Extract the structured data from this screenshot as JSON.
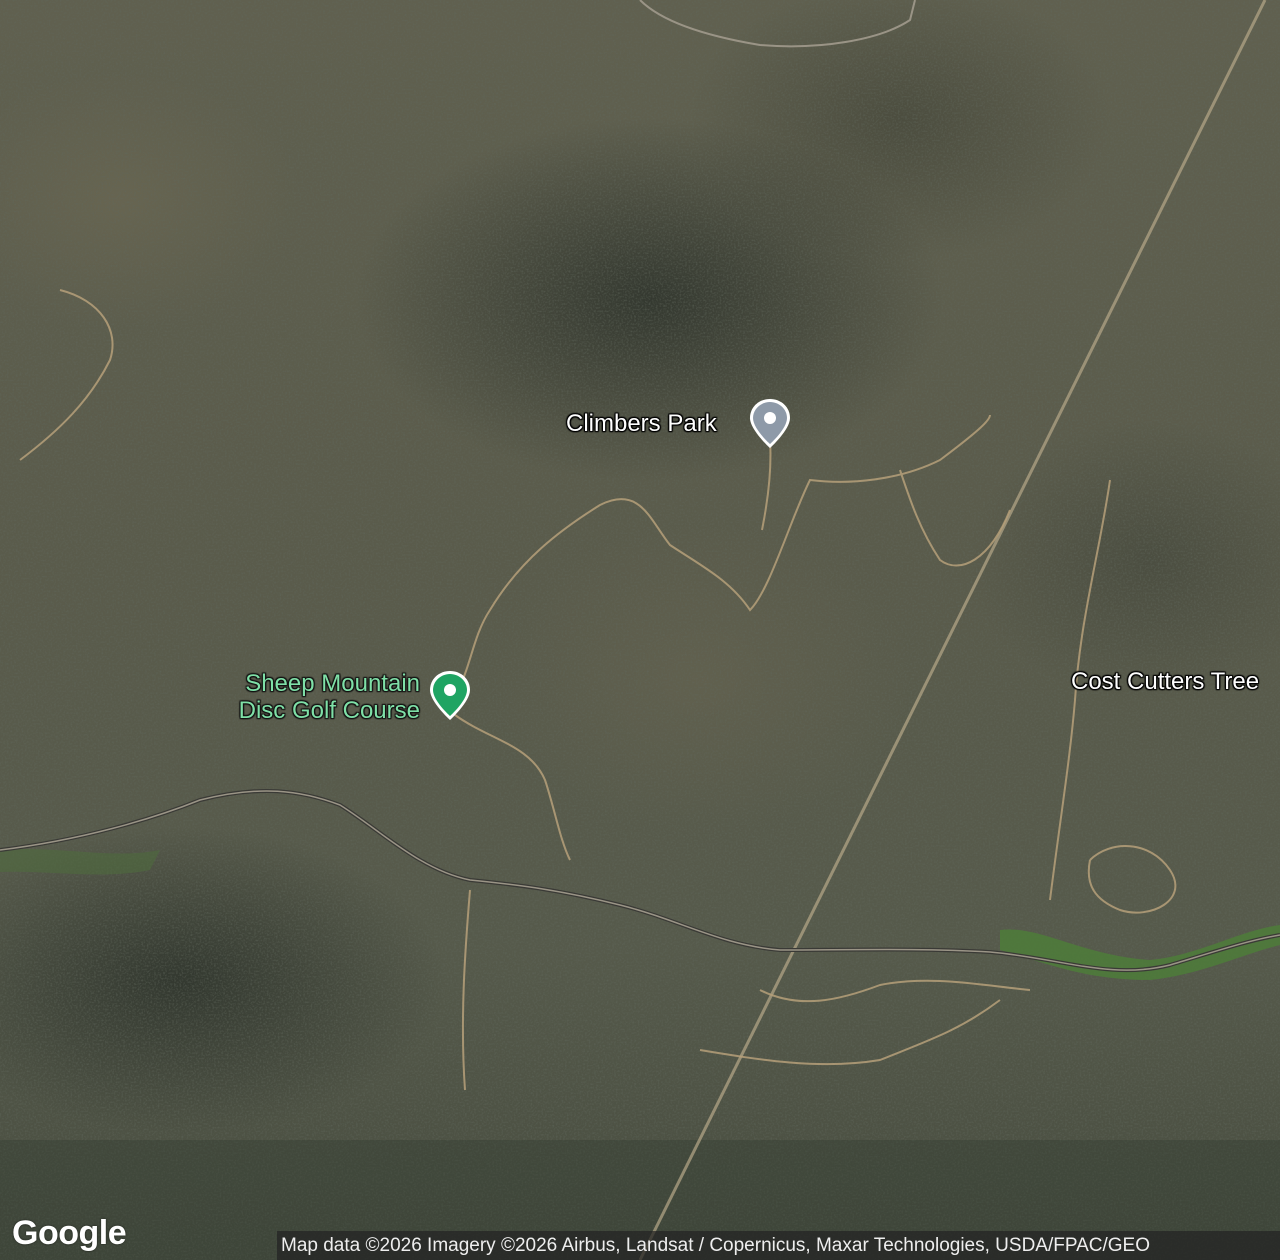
{
  "map": {
    "type": "satellite",
    "places": [
      {
        "name": "Climbers Park",
        "category": "park",
        "color": "#8e9aa8"
      },
      {
        "name_line1": "Sheep Mountain",
        "name_line2": "Disc Golf Course",
        "category": "recreation",
        "color": "#1fa463"
      },
      {
        "name": "Cost Cutters Tree",
        "category": "business-partial"
      }
    ],
    "logo": "Google",
    "attribution": "Map data ©2026 Imagery ©2026 Airbus, Landsat / Copernicus, Maxar Technologies, USDA/FPAC/GEO"
  }
}
